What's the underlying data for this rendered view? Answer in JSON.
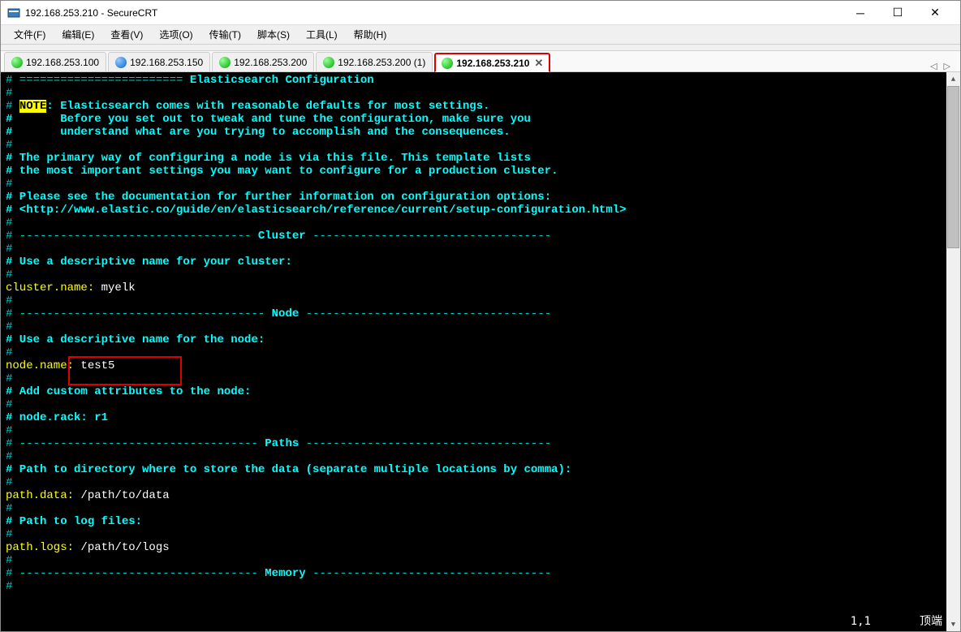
{
  "window": {
    "title": "192.168.253.210 - SecureCRT"
  },
  "menu": [
    "文件(F)",
    "编辑(E)",
    "查看(V)",
    "选项(O)",
    "传输(T)",
    "脚本(S)",
    "工具(L)",
    "帮助(H)"
  ],
  "tabs": [
    {
      "label": "192.168.253.100",
      "icon": "green"
    },
    {
      "label": "192.168.253.150",
      "icon": "blue"
    },
    {
      "label": "192.168.253.200",
      "icon": "green"
    },
    {
      "label": "192.168.253.200 (1)",
      "icon": "green"
    },
    {
      "label": "192.168.253.210",
      "icon": "green",
      "active": true
    }
  ],
  "tabnav": {
    "left": "◁",
    "right": "▷"
  },
  "status": {
    "pos": "1,1",
    "mode": "顶端"
  },
  "term": {
    "l1a": "# ======================== ",
    "l1b": "Elasticsearch Configuration",
    " l1c": " =========================",
    "l2": "#",
    "l3a": "# ",
    "l3b": "NOTE",
    "l3c": ": Elasticsearch comes with reasonable defaults for most settings.",
    "l4": "#       Before you set out to tweak and tune the configuration, make sure you",
    "l5": "#       understand what are you trying to accomplish and the consequences.",
    "l6": "#",
    "l7": "# The primary way of configuring a node is via this file. This template lists",
    "l8": "# the most important settings you may want to configure for a production cluster.",
    "l9": "#",
    "l10": "# Please see the documentation for further information on configuration options:",
    "l11": "# <http://www.elastic.co/guide/en/elasticsearch/reference/current/setup-configuration.html>",
    "l12": "#",
    "l13a": "# ---------------------------------- ",
    "l13b": "Cluster",
    "l13c": " -----------------------------------",
    "l14": "#",
    "l15": "# Use a descriptive name for your cluster:",
    "l16": "#",
    "l17a": "cluster.name:",
    "l17b": " myelk",
    "l18": "#",
    "l19a": "# ------------------------------------ ",
    "l19b": "Node",
    "l19c": " ------------------------------------",
    "l20": "#",
    "l21": "# Use a descriptive name for the node:",
    "l22": "#",
    "l23a": "node.name:",
    "l23b": " test5",
    "l24": "#",
    "l25": "# Add custom attributes to the node:",
    "l26": "#",
    "l27": "# node.rack: r1",
    "l28": "#",
    "l29a": "# ----------------------------------- ",
    "l29b": "Paths",
    "l29c": " ------------------------------------",
    "l30": "#",
    "l31": "# Path to directory where to store the data (separate multiple locations by comma):",
    "l32": "#",
    "l33a": "path.data:",
    "l33b": " /path/to/data",
    "l34": "#",
    "l35": "# Path to log files:",
    "l36": "#",
    "l37a": "path.logs:",
    "l37b": " /path/to/logs",
    "l38": "#",
    "l39a": "# ----------------------------------- ",
    "l39b": "Memory",
    "l39c": " -----------------------------------",
    "l40": "#"
  }
}
